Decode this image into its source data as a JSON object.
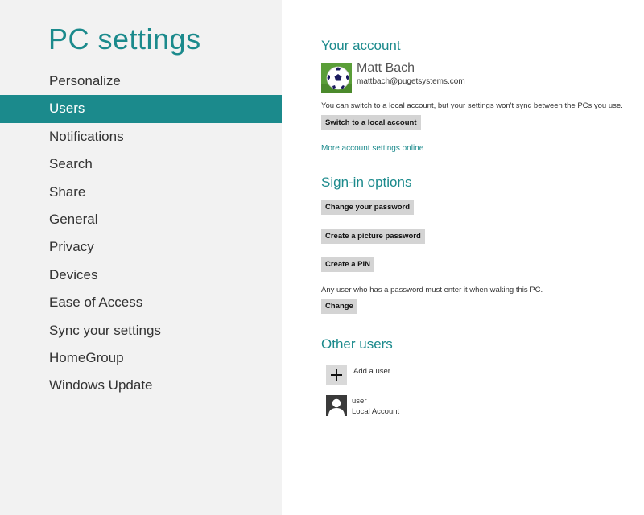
{
  "app_title": "PC settings",
  "nav": [
    {
      "label": "Personalize"
    },
    {
      "label": "Users",
      "selected": true
    },
    {
      "label": "Notifications"
    },
    {
      "label": "Search"
    },
    {
      "label": "Share"
    },
    {
      "label": "General"
    },
    {
      "label": "Privacy"
    },
    {
      "label": "Devices"
    },
    {
      "label": "Ease of Access"
    },
    {
      "label": "Sync your settings"
    },
    {
      "label": "HomeGroup"
    },
    {
      "label": "Windows Update"
    }
  ],
  "your_account": {
    "title": "Your account",
    "name": "Matt Bach",
    "email": "mattbach@pugetsystems.com",
    "info": "You can switch to a local account, but your settings won't sync between the PCs you use.",
    "switch_button": "Switch to a local account",
    "more_link": "More account settings online"
  },
  "sign_in": {
    "title": "Sign-in options",
    "change_password": "Change your password",
    "picture_password": "Create a picture password",
    "create_pin": "Create a PIN",
    "wake_text": "Any user who has a password must enter it when waking this PC.",
    "change_button": "Change"
  },
  "other_users": {
    "title": "Other users",
    "add_label": "Add a user",
    "user_name": "user",
    "user_type": "Local Account"
  },
  "colors": {
    "accent": "#1b8a8c",
    "nav_background": "#f2f2f2",
    "button_background": "#d4d4d4"
  }
}
